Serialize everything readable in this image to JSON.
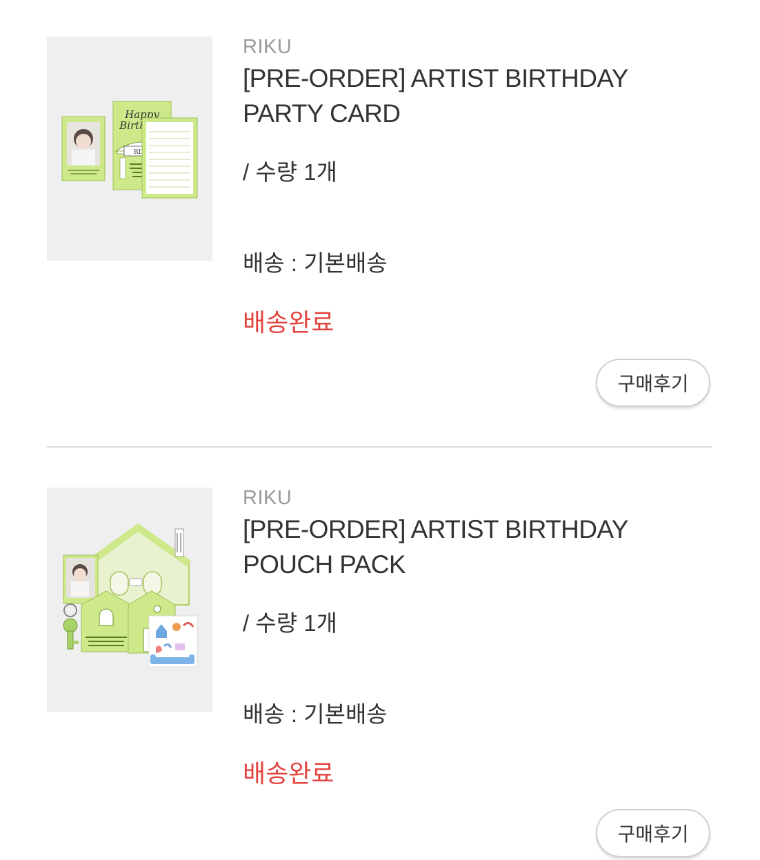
{
  "orders": [
    {
      "brand": "RIKU",
      "title": "[PRE-ORDER] ARTIST BIRTHDAY PARTY CARD",
      "quantity": "/ 수량 1개",
      "shipping": "배송 : 기본배송",
      "status": "배송완료",
      "review_button": "구매후기",
      "image_text": {
        "script_line1": "Happy",
        "script_line2": "Birthday",
        "name": "RIKU"
      }
    },
    {
      "brand": "RIKU",
      "title": "[PRE-ORDER] ARTIST BIRTHDAY POUCH PACK",
      "quantity": "/ 수량 1개",
      "shipping": "배송 : 기본배송",
      "status": "배송완료",
      "review_button": "구매후기"
    }
  ],
  "colors": {
    "status": "#e3443f",
    "brand": "#9a9a9a",
    "product_green": "#cde98a"
  }
}
